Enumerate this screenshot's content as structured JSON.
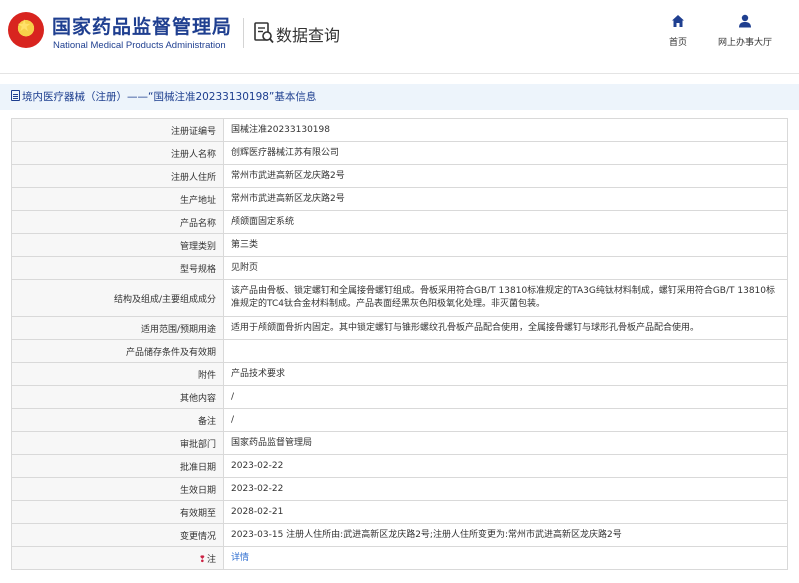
{
  "header": {
    "title": "国家药品监督管理局",
    "subtitle": "National Medical Products Administration",
    "query_label": "数据查询",
    "nav": [
      {
        "label": "首页",
        "icon": "home-icon"
      },
      {
        "label": "网上办事大厅",
        "icon": "user-icon"
      }
    ]
  },
  "breadcrumb": {
    "text": "境内医疗器械（注册）——“国械注准20233130198”基本信息"
  },
  "table": {
    "rows": [
      {
        "label": "注册证编号",
        "value": "国械注准20233130198"
      },
      {
        "label": "注册人名称",
        "value": "创辉医疗器械江苏有限公司"
      },
      {
        "label": "注册人住所",
        "value": "常州市武进高新区龙庆路2号"
      },
      {
        "label": "生产地址",
        "value": "常州市武进高新区龙庆路2号"
      },
      {
        "label": "产品名称",
        "value": "颅颌面固定系统"
      },
      {
        "label": "管理类别",
        "value": "第三类"
      },
      {
        "label": "型号规格",
        "value": "见附页"
      },
      {
        "label": "结构及组成/主要组成成分",
        "value": "该产品由骨板、锁定螺钉和全属接骨螺钉组成。骨板采用符合GB/T 13810标准规定的TA3G纯钛材料制成，螺钉采用符合GB/T 13810标准规定的TC4钛合金材料制成。产品表面经黑灰色阳极氧化处理。非灭菌包装。"
      },
      {
        "label": "适用范围/预期用途",
        "value": "适用于颅颌面骨折内固定。其中锁定螺钉与锥形螺纹孔骨板产品配合使用，全属接骨螺钉与球形孔骨板产品配合使用。"
      },
      {
        "label": "产品储存条件及有效期",
        "value": ""
      },
      {
        "label": "附件",
        "value": "产品技术要求"
      },
      {
        "label": "其他内容",
        "value": "/"
      },
      {
        "label": "备注",
        "value": "/"
      },
      {
        "label": "审批部门",
        "value": "国家药品监督管理局"
      },
      {
        "label": "批准日期",
        "value": "2023-02-22"
      },
      {
        "label": "生效日期",
        "value": "2023-02-22"
      },
      {
        "label": "有效期至",
        "value": "2028-02-21"
      },
      {
        "label": "变更情况",
        "value": "2023-03-15 注册人住所由:武进高新区龙庆路2号;注册人住所变更为:常州市武进高新区龙庆路2号"
      },
      {
        "label": "注",
        "value": "详情"
      }
    ]
  },
  "colors": {
    "brand_blue": "#1f3f90",
    "emblem_red": "#d8241f",
    "link_blue": "#2f6fd1",
    "breadcrumb_bg": "#edf4fb"
  }
}
